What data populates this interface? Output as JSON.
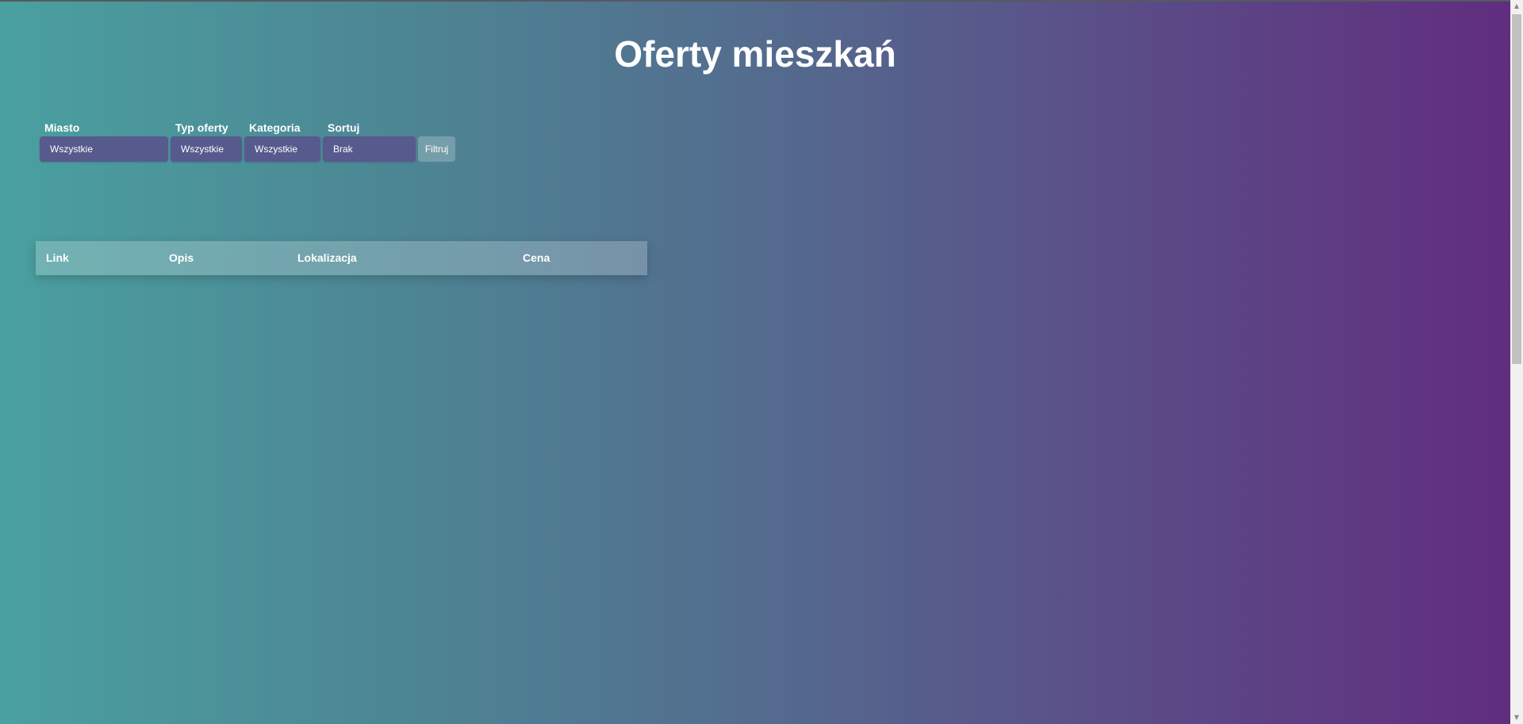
{
  "page": {
    "title": "Oferty mieszkań"
  },
  "filters": {
    "city": {
      "label": "Miasto",
      "selected": "Wszystkie"
    },
    "offer_type": {
      "label": "Typ oferty",
      "selected": "Wszystkie"
    },
    "category": {
      "label": "Kategoria",
      "selected": "Wszystkie"
    },
    "sort": {
      "label": "Sortuj",
      "selected": "Brak"
    },
    "submit_label": "Filtruj"
  },
  "table": {
    "columns": [
      "Link",
      "Opis",
      "Lokalizacja",
      "Cena"
    ],
    "rows": []
  },
  "scrollbar": {
    "up_icon": "triangle-up",
    "down_icon": "triangle-down"
  }
}
